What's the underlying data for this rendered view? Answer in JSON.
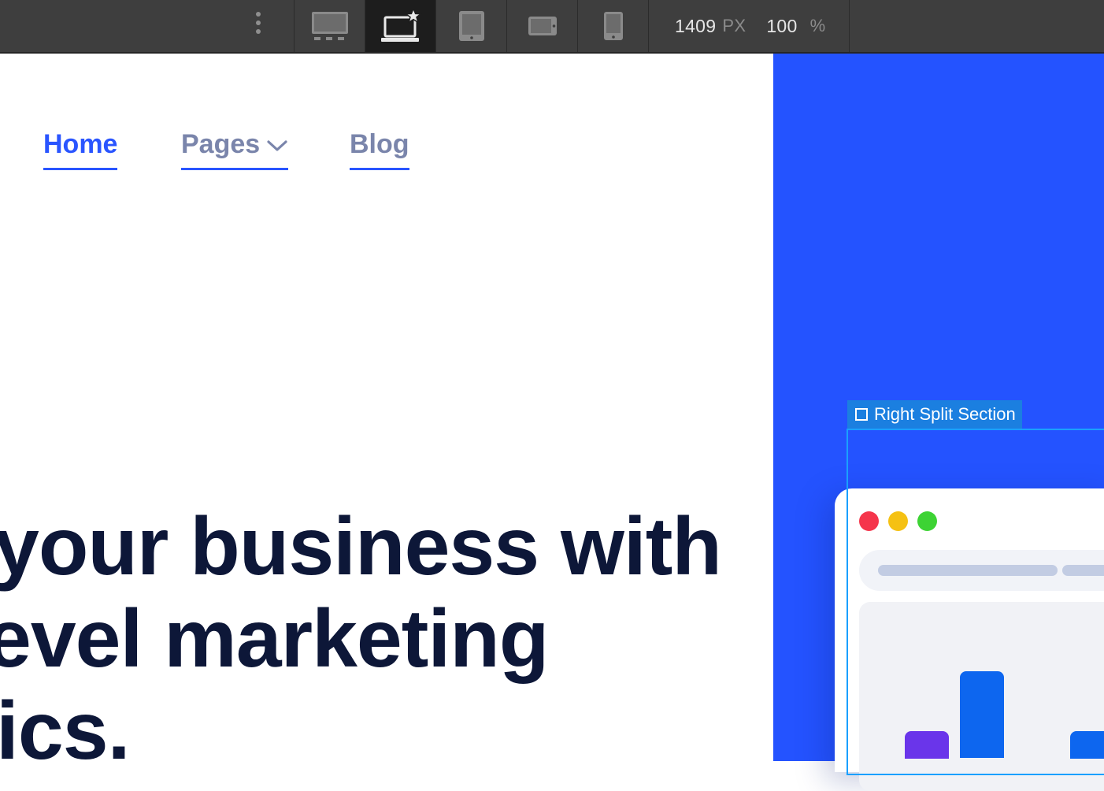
{
  "toolbar": {
    "breakpoints": [
      {
        "icon": "desktop-icon",
        "active": false
      },
      {
        "icon": "laptop-base-icon",
        "active": true
      },
      {
        "icon": "tablet-icon",
        "active": false
      },
      {
        "icon": "mobile-landscape-icon",
        "active": false
      },
      {
        "icon": "mobile-portrait-icon",
        "active": false
      }
    ],
    "width_value": "1409",
    "width_unit": "PX",
    "zoom_value": "100",
    "zoom_unit": "%"
  },
  "nav": {
    "items": [
      {
        "label": "Home",
        "active": true
      },
      {
        "label": "Pages",
        "has_dropdown": true
      },
      {
        "label": "Blog"
      }
    ]
  },
  "hero": {
    "lines": [
      "your business with",
      "evel marketing",
      "ics."
    ]
  },
  "selection": {
    "label": "Right Split Section"
  },
  "mockup": {
    "window_dots": [
      "#f5354b",
      "#f5c113",
      "#3dd334"
    ],
    "chart_data": {
      "type": "bar",
      "values": [
        0.15,
        0.48,
        0.15
      ],
      "colors": [
        "#6a35ea",
        "#0d66ef",
        "#0d66ef"
      ]
    }
  },
  "colors": {
    "accent": "#2a55ff",
    "split_blue": "#2453ff",
    "selection": "#1b7fe0",
    "heading": "#0d1738"
  }
}
